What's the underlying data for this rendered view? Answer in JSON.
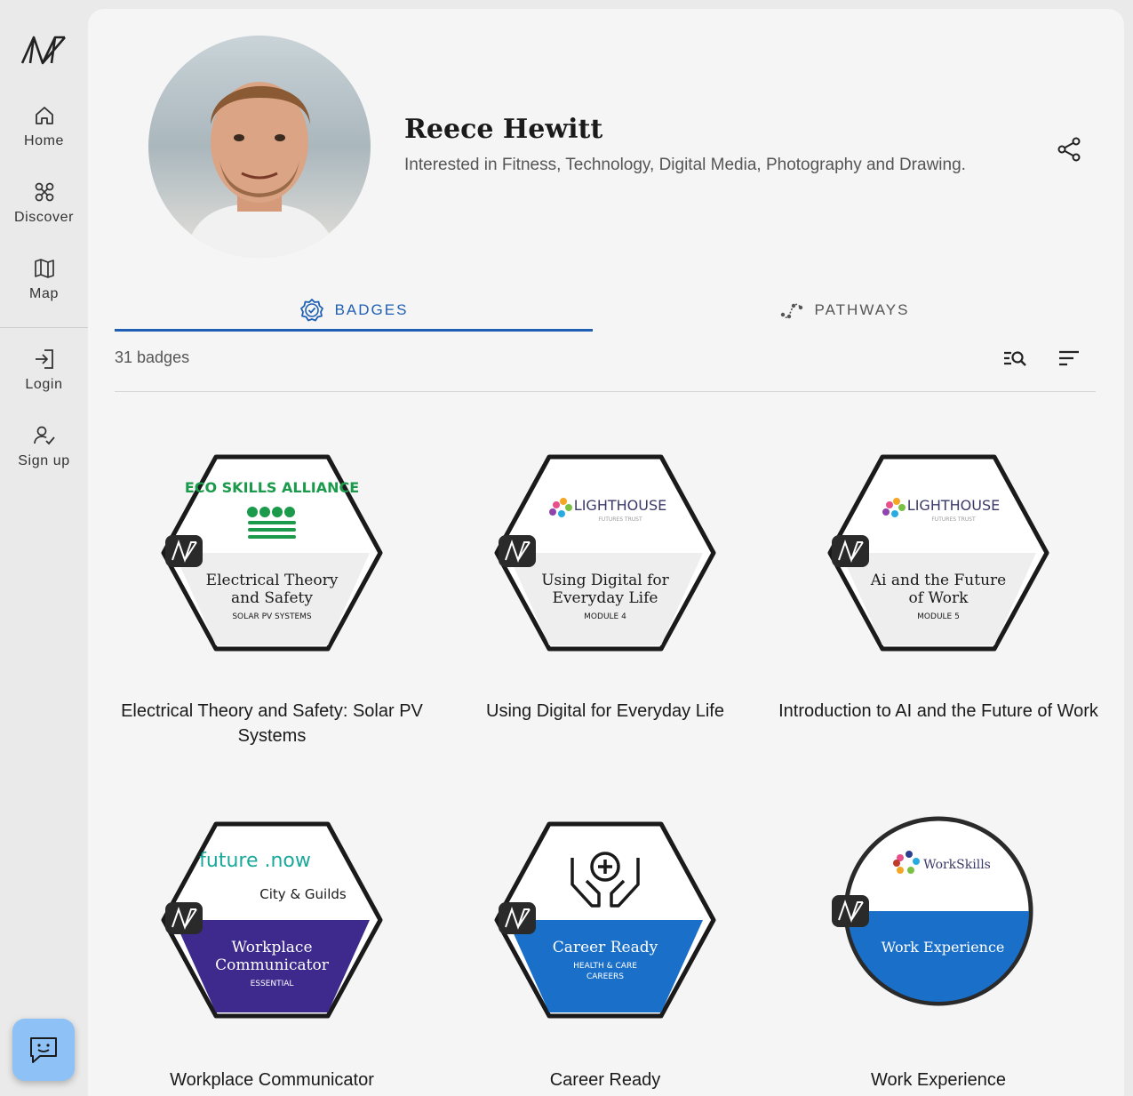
{
  "nav": {
    "items": [
      {
        "label": "Home",
        "icon": "home-icon"
      },
      {
        "label": "Discover",
        "icon": "discover-icon"
      },
      {
        "label": "Map",
        "icon": "map-icon"
      },
      {
        "label": "Login",
        "icon": "login-icon"
      },
      {
        "label": "Sign up",
        "icon": "sign-up-icon"
      }
    ]
  },
  "profile": {
    "name": "Reece Hewitt",
    "bio": "Interested in Fitness, Technology, Digital Media, Photography and Drawing."
  },
  "tabs": [
    {
      "label": "BADGES",
      "active": true
    },
    {
      "label": "PATHWAYS",
      "active": false
    }
  ],
  "badges_summary": {
    "count_text": "31 badges"
  },
  "badges": [
    {
      "title": "Electrical Theory and Safety: Solar PV Systems",
      "issuer_logo": "ECO SKILLS ALLIANCE",
      "image_line1": "Electrical Theory",
      "image_line2": "and Safety",
      "image_sub": "SOLAR PV SYSTEMS",
      "theme": "white"
    },
    {
      "title": "Using Digital for Everyday Life",
      "issuer_logo": "LIGHTHOUSE",
      "issuer_sub": "FUTURES TRUST",
      "image_line1": "Using Digital for",
      "image_line2": "Everyday Life",
      "image_sub": "MODULE 4",
      "theme": "white"
    },
    {
      "title": "Introduction to AI and the Future of Work",
      "issuer_logo": "LIGHTHOUSE",
      "issuer_sub": "FUTURES TRUST",
      "image_line1": "Ai and the Future",
      "image_line2": "of Work",
      "image_sub": "MODULE 5",
      "theme": "white"
    },
    {
      "title": "Workplace Communicator",
      "issuer_logo": "future .now",
      "issuer_logo_2": "City & Guilds",
      "image_line1": "Workplace",
      "image_line2": "Communicator",
      "image_sub": "ESSENTIAL",
      "theme": "purple",
      "accent": "#3d2a8c"
    },
    {
      "title": "Career Ready",
      "issuer_logo": "hands-cross-icon",
      "image_line1": "Career Ready",
      "image_sub": "HEALTH & CARE",
      "image_sub2": "CAREERS",
      "theme": "blue",
      "accent": "#1a6fc9"
    },
    {
      "title": "Work Experience",
      "issuer_logo": "WorkSkills",
      "image_line1": "Work Experience",
      "theme": "blue-circle",
      "accent": "#1a6fc9"
    }
  ],
  "colors": {
    "accent": "#1f5fb3",
    "fab": "#8ec1f5",
    "page_bg": "#ebeaea",
    "card_bg": "#f5f5f5"
  }
}
